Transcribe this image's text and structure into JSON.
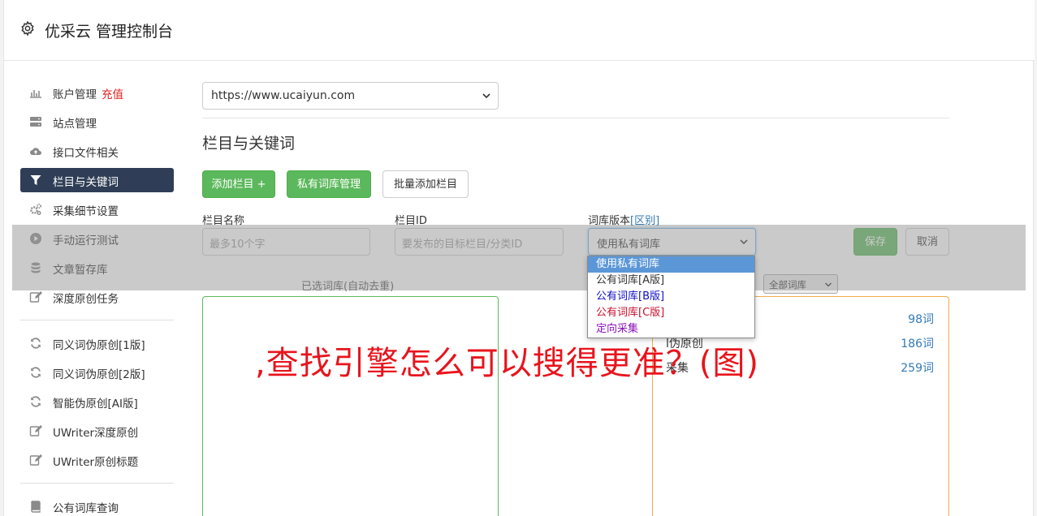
{
  "header": {
    "title": "优采云 管理控制台",
    "icon": "gear-icon"
  },
  "sidebar": {
    "items": [
      {
        "label": "账户管理",
        "badge": "充值",
        "icon": "bar-chart-icon"
      },
      {
        "label": "站点管理",
        "icon": "server-icon"
      },
      {
        "label": "接口文件相关",
        "icon": "cloud-upload-icon"
      },
      {
        "label": "栏目与关键词",
        "icon": "filter-icon",
        "active": true
      },
      {
        "label": "采集细节设置",
        "icon": "cogs-icon"
      },
      {
        "label": "手动运行测试",
        "icon": "play-circle-icon"
      },
      {
        "label": "文章暂存库",
        "icon": "database-icon"
      },
      {
        "label": "深度原创任务",
        "icon": "edit-icon"
      },
      {
        "label": "同义词伪原创[1版]",
        "icon": "refresh-icon"
      },
      {
        "label": "同义词伪原创[2版]",
        "icon": "refresh-icon"
      },
      {
        "label": "智能伪原创[AI版]",
        "icon": "refresh-icon"
      },
      {
        "label": "UWriter深度原创",
        "icon": "edit-icon"
      },
      {
        "label": "UWriter原创标题",
        "icon": "edit-icon"
      },
      {
        "label": "公有词库查询",
        "icon": "book-icon"
      }
    ]
  },
  "main": {
    "site_select": "https://www.ucaiyun.com",
    "section_title": "栏目与关键词",
    "buttons": {
      "add_column": "添加栏目 +",
      "private_lib": "私有词库管理",
      "batch_add": "批量添加栏目",
      "save": "保存",
      "cancel": "取消"
    },
    "form": {
      "name_label": "栏目名称",
      "name_placeholder": "最多10个字",
      "id_label": "栏目ID",
      "id_placeholder": "要发布的目标栏目/分类ID",
      "version_label": "词库版本",
      "version_link": "[区别]",
      "version_value": "使用私有词库",
      "version_options": [
        "使用私有词库",
        "公有词库[A版]",
        "公有词库[B版]",
        "公有词库[C版]",
        "定向采集"
      ]
    },
    "selected_lib_label": "已选词库(自动去重)",
    "all_lib_select": "全部词库",
    "libraries": [
      {
        "name": "",
        "count": "98词"
      },
      {
        "name": "l伪原创",
        "count": "186词"
      },
      {
        "name": "采集",
        "count": "259词"
      }
    ]
  },
  "watermark": ",查找引擎怎么可以搜得更准？(图)",
  "colors": {
    "accent_green": "#5cb85c",
    "sidebar_active": "#2f3e56",
    "link_blue": "#337ab7",
    "watermark_red": "#e8141c"
  }
}
